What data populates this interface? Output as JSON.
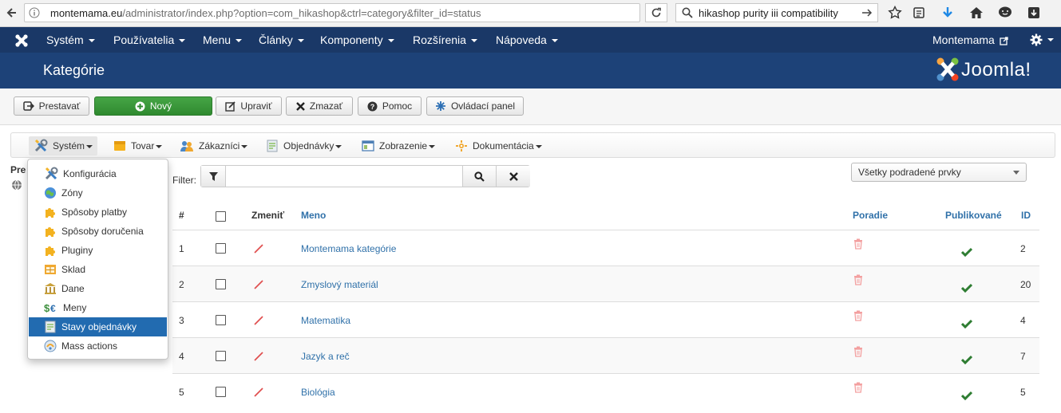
{
  "browser": {
    "url_domain": "montemama.eu",
    "url_path": "/administrator/index.php?option=com_hikashop&ctrl=category&filter_id=status",
    "search_text": "hikashop purity iii compatibility"
  },
  "topnav": {
    "items": [
      "Systém",
      "Používatelia",
      "Menu",
      "Články",
      "Komponenty",
      "Rozšírenia",
      "Nápoveda"
    ],
    "site_name": "Montemama"
  },
  "header": {
    "title": "Kategórie",
    "brand": "Joomla!"
  },
  "toolbar": {
    "buttons": [
      "Prestavať",
      "Nový",
      "Upraviť",
      "Zmazať",
      "Pomoc",
      "Ovládací panel"
    ]
  },
  "hikamenu": {
    "items": [
      "Systém",
      "Tovar",
      "Zákazníci",
      "Objednávky",
      "Zobrazenie",
      "Dokumentácia"
    ]
  },
  "dropdown": {
    "items": [
      "Konfigurácia",
      "Zóny",
      "Spôsoby platby",
      "Spôsoby doručenia",
      "Pluginy",
      "Sklad",
      "Dane",
      "Meny",
      "Stavy objednávky",
      "Mass actions"
    ],
    "selected_index": 8
  },
  "left_fragment": "Pre",
  "filter": {
    "label": "Filter:",
    "value": "",
    "select_value": "Všetky podradené prvky"
  },
  "table": {
    "headers": {
      "num": "#",
      "edit": "Zmeniť",
      "name": "Meno",
      "order": "Poradie",
      "published": "Publikované",
      "id": "ID"
    },
    "rows": [
      {
        "num": "1",
        "name": "Montemama kategórie",
        "id": "2"
      },
      {
        "num": "2",
        "name": "Zmyslový materiál",
        "id": "20"
      },
      {
        "num": "3",
        "name": "Matematika",
        "id": "4"
      },
      {
        "num": "4",
        "name": "Jazyk a reč",
        "id": "7"
      },
      {
        "num": "5",
        "name": "Biológia",
        "id": "5"
      }
    ]
  },
  "colors": {
    "nav_bg": "#1a3867",
    "header_bg": "#1d4278",
    "link": "#3071a9",
    "green_button": "#46a546",
    "selected_item": "#226bb0",
    "publish_check": "#2e7d32",
    "edit_pencil": "#e05050"
  }
}
